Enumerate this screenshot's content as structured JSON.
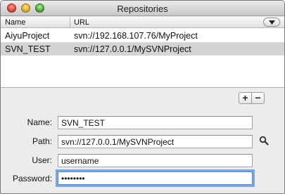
{
  "window": {
    "title": "Repositories"
  },
  "table": {
    "columns": {
      "name": "Name",
      "url": "URL"
    },
    "column_menu_icon": "chevron-down-icon",
    "rows": [
      {
        "name": "AiyuProject",
        "url": "svn://192.168.107.76/MyProject",
        "selected": false
      },
      {
        "name": "SVN_TEST",
        "url": "svn://127.0.0.1/MySVNProject",
        "selected": true
      }
    ]
  },
  "controls": {
    "add_label": "+",
    "remove_label": "−"
  },
  "form": {
    "name_label": "Name:",
    "name_value": "SVN_TEST",
    "path_label": "Path:",
    "path_value": "svn://127.0.0.1/MySVNProject",
    "user_label": "User:",
    "user_value": "username",
    "password_label": "Password:",
    "password_value": "password"
  },
  "colors": {
    "selection": "#d4d4d4",
    "focus_ring": "#7aa7e0"
  }
}
